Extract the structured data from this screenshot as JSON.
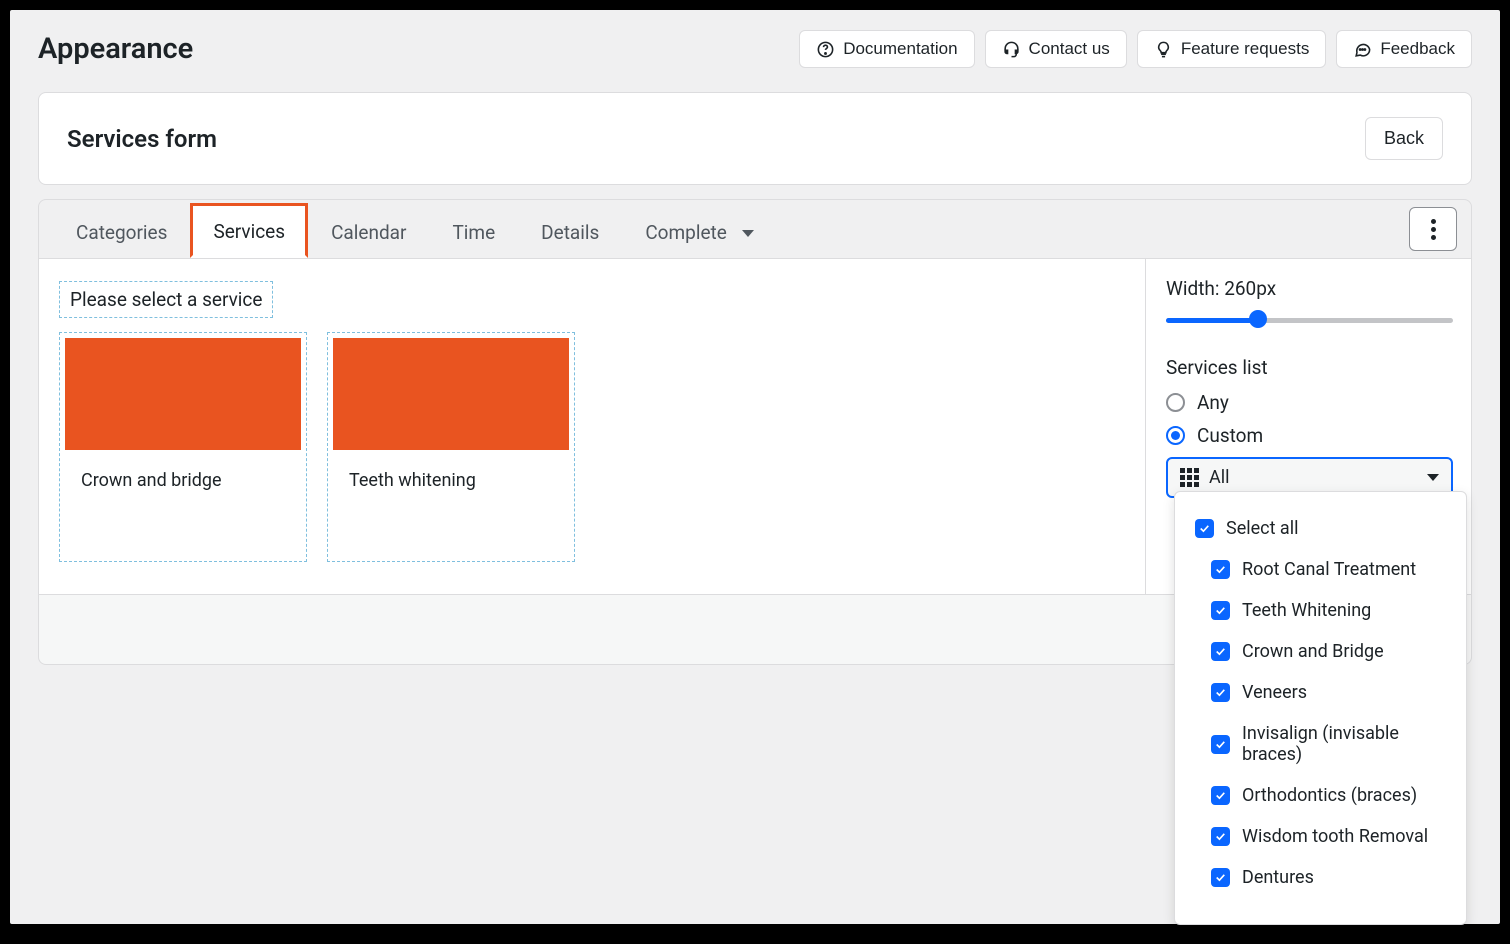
{
  "header": {
    "title": "Appearance",
    "buttons": {
      "documentation": "Documentation",
      "contact": "Contact us",
      "feature": "Feature requests",
      "feedback": "Feedback"
    }
  },
  "panel": {
    "title": "Services form",
    "back": "Back"
  },
  "tabs": {
    "categories": "Categories",
    "services": "Services",
    "calendar": "Calendar",
    "time": "Time",
    "details": "Details",
    "complete": "Complete"
  },
  "canvas": {
    "prompt": "Please select a service",
    "card1": "Crown and bridge",
    "card2": "Teeth whitening"
  },
  "sidebar": {
    "widthLabel": "Width: 260px",
    "servicesList": "Services list",
    "radioAny": "Any",
    "radioCustom": "Custom",
    "selectValue": "All"
  },
  "dropdown": {
    "selectAll": "Select all",
    "items": [
      "Root Canal Treatment",
      "Teeth Whitening",
      "Crown and Bridge",
      "Veneers",
      "Invisalign (invisable braces)",
      "Orthodontics (braces)",
      "Wisdom tooth Removal",
      "Dentures"
    ]
  }
}
